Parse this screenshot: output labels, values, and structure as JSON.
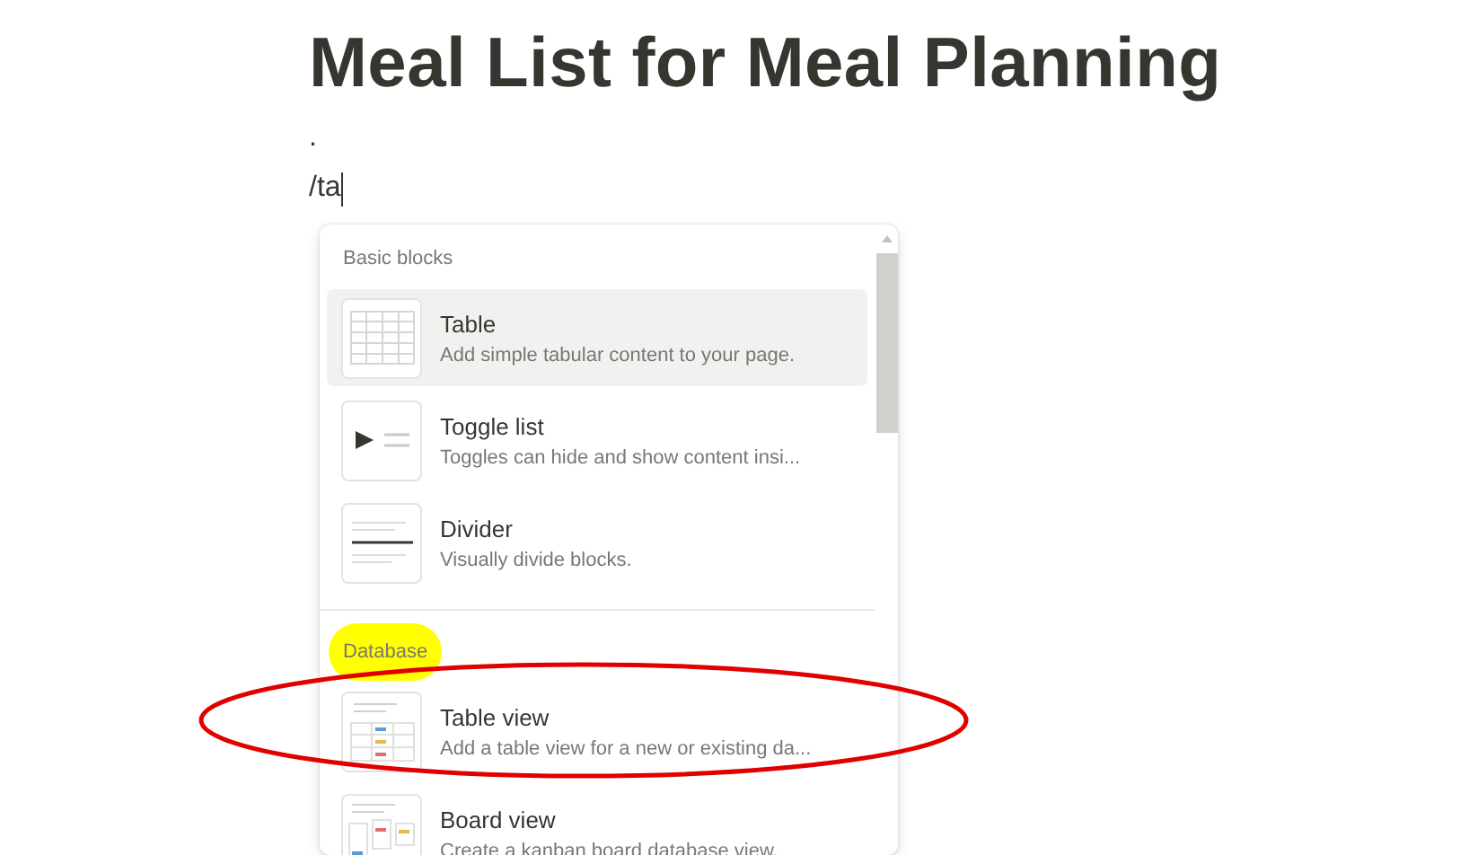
{
  "page": {
    "title": "Meal List for Meal Planning",
    "blocks": [
      ".",
      "/ta"
    ]
  },
  "menu": {
    "sections": [
      {
        "heading": "Basic blocks",
        "highlighted": false,
        "items": [
          {
            "kind": "table",
            "title": "Table",
            "description": "Add simple tabular content to your page.",
            "selected": true
          },
          {
            "kind": "toggle",
            "title": "Toggle list",
            "description": "Toggles can hide and show content insi...",
            "selected": false
          },
          {
            "kind": "divider",
            "title": "Divider",
            "description": "Visually divide blocks.",
            "selected": false
          }
        ]
      },
      {
        "heading": "Database",
        "highlighted": true,
        "items": [
          {
            "kind": "table-view",
            "title": "Table view",
            "description": "Add a table view for a new or existing da...",
            "selected": false,
            "circled": true
          },
          {
            "kind": "board-view",
            "title": "Board view",
            "description": "Create a kanban board database view.",
            "selected": false,
            "circled": false
          }
        ]
      }
    ]
  }
}
